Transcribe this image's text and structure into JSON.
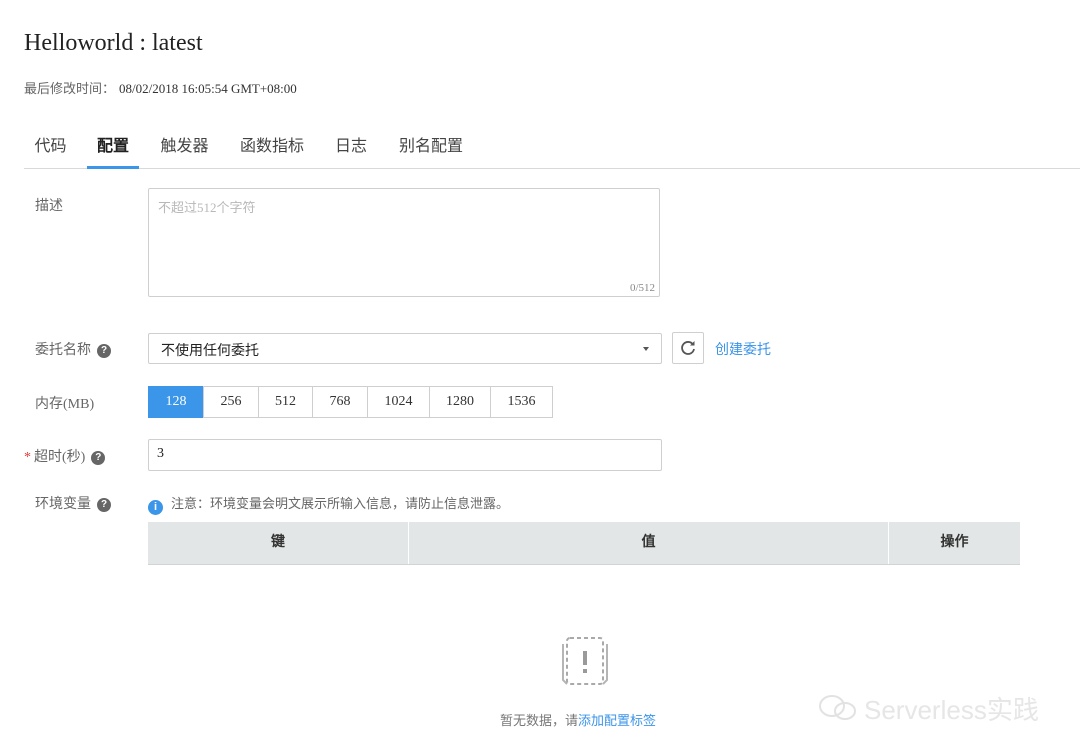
{
  "header": {
    "title": "Helloworld : latest",
    "modified_label": "最后修改时间：",
    "modified_value": "08/02/2018 16:05:54 GMT+08:00"
  },
  "tabs": [
    {
      "label": "代码",
      "active": false
    },
    {
      "label": "配置",
      "active": true
    },
    {
      "label": "触发器",
      "active": false
    },
    {
      "label": "函数指标",
      "active": false
    },
    {
      "label": "日志",
      "active": false
    },
    {
      "label": "别名配置",
      "active": false
    }
  ],
  "form": {
    "description": {
      "label": "描述",
      "placeholder": "不超过512个字符",
      "counter": "0/512"
    },
    "agency": {
      "label": "委托名称",
      "selected": "不使用任何委托",
      "create_link": "创建委托"
    },
    "memory": {
      "label": "内存(MB)",
      "options": [
        "128",
        "256",
        "512",
        "768",
        "1024",
        "1280",
        "1536"
      ],
      "selected": "128"
    },
    "timeout": {
      "required_mark": "*",
      "label": "超时(秒)",
      "value": "3"
    },
    "env": {
      "label": "环境变量",
      "note": "注意：环境变量会明文展示所输入信息，请防止信息泄露。",
      "columns": [
        "键",
        "值",
        "操作"
      ],
      "empty_text": "暂无数据，请",
      "empty_link": "添加配置标签"
    }
  },
  "watermark": "Serverless实践",
  "colors": {
    "accent": "#3b95e8",
    "required": "#e23b3b",
    "table_header": "#e3e6e6"
  }
}
